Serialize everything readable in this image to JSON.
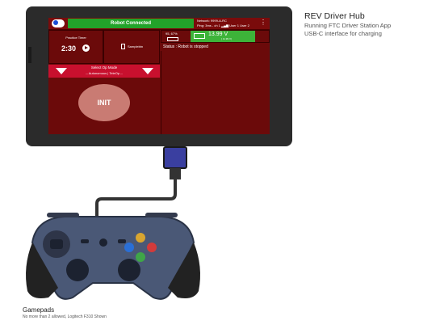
{
  "hub_label": {
    "title": "REV Driver Hub",
    "line1": "Running FTC Driver Station App",
    "line2": "USB-C interface for charging"
  },
  "gamepad_label": {
    "title": "Gamepads",
    "subtitle": "No more than 2 allowed, Logitech F310 Shown"
  },
  "app": {
    "status": "Robot Connected",
    "network_line1": "Network: 9999-A-RC",
    "network_line2": "Ping: 3ms - ch 1",
    "user1": "User 1",
    "user2": "User 2",
    "timer_label": "Practice Timer",
    "timer_value": "2:30",
    "sample_label": "Samplebtn",
    "phone_battery": "95, 67%",
    "robot_voltage": "13.99 V",
    "robot_voltage_sub": "( 11.99 V)",
    "opmode_title": "Select Op Mode",
    "opmode_sub": "-- Autonomous | TeleOp --",
    "init_label": "INIT",
    "robot_status": "Status : Robot is stopped"
  },
  "colors": {
    "screen_bg": "#6b0a0a",
    "connected_green": "#22a32a",
    "opmode_red": "#c8102e",
    "init_pink": "#c97b73",
    "usb_blue": "#3a3fa0"
  },
  "gamepad": {
    "brand": "Logitech",
    "buttons": [
      "blue",
      "yellow",
      "green",
      "red"
    ]
  }
}
